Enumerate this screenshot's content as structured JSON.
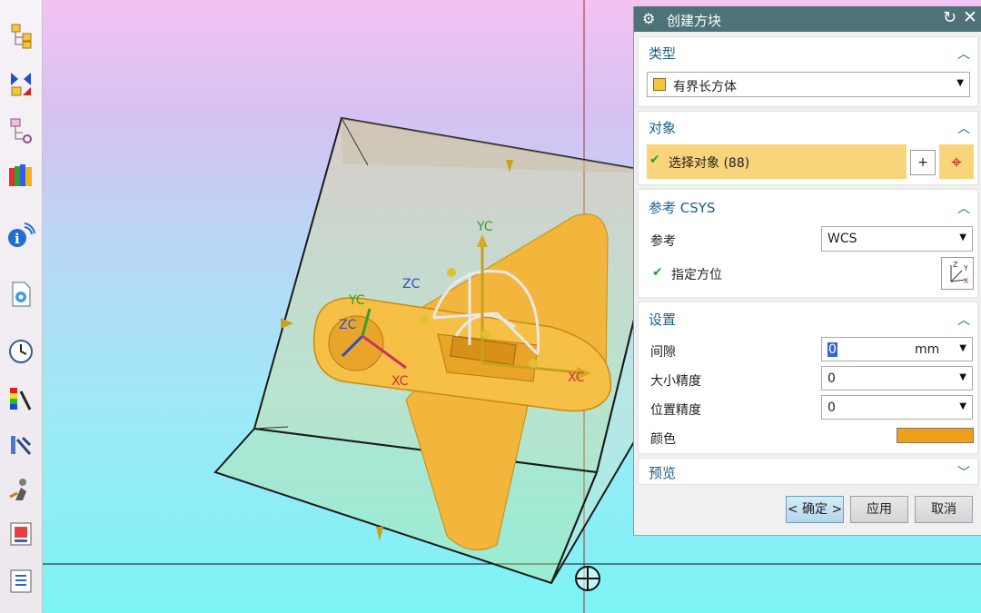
{
  "toolbar": {
    "icons": [
      "assembly-navigator-icon",
      "constraint-icon",
      "part-navigator-icon",
      "reuse-library-icon",
      "info-icon",
      "document-icon",
      "history-icon",
      "color-palette-icon",
      "tools-icon",
      "roles-icon",
      "layout-icon",
      "list-icon"
    ]
  },
  "viewport": {
    "axis_labels": {
      "yc_top": "YC",
      "zc_top": "ZC",
      "yc_left": "YC",
      "zc_left": "ZC",
      "xc_center": "XC",
      "xc_right": "XC"
    },
    "colors": {
      "part": "#f2b63c",
      "box": "#c8d08a",
      "box_edge": "#1b1b1b"
    }
  },
  "dialog": {
    "title": "创建方块",
    "icons": {
      "settings": "gear-icon",
      "reset": "reset-icon",
      "close": "close-icon"
    },
    "type": {
      "header": "类型",
      "selected": "有界长方体"
    },
    "object": {
      "header": "对象",
      "select_label": "选择对象 (88)"
    },
    "csys": {
      "header": "参考 CSYS",
      "reference_label": "参考",
      "reference_value": "WCS",
      "orient_label": "指定方位"
    },
    "settings": {
      "header": "设置",
      "gap_label": "间隙",
      "gap_value": "0",
      "gap_unit": "mm",
      "size_precision_label": "大小精度",
      "size_precision_value": "0",
      "position_precision_label": "位置精度",
      "position_precision_value": "0",
      "color_label": "颜色",
      "color_value": "#f0a018"
    },
    "preview": {
      "header": "预览"
    },
    "buttons": {
      "ok": "< 确定 >",
      "apply": "应用",
      "cancel": "取消"
    }
  }
}
